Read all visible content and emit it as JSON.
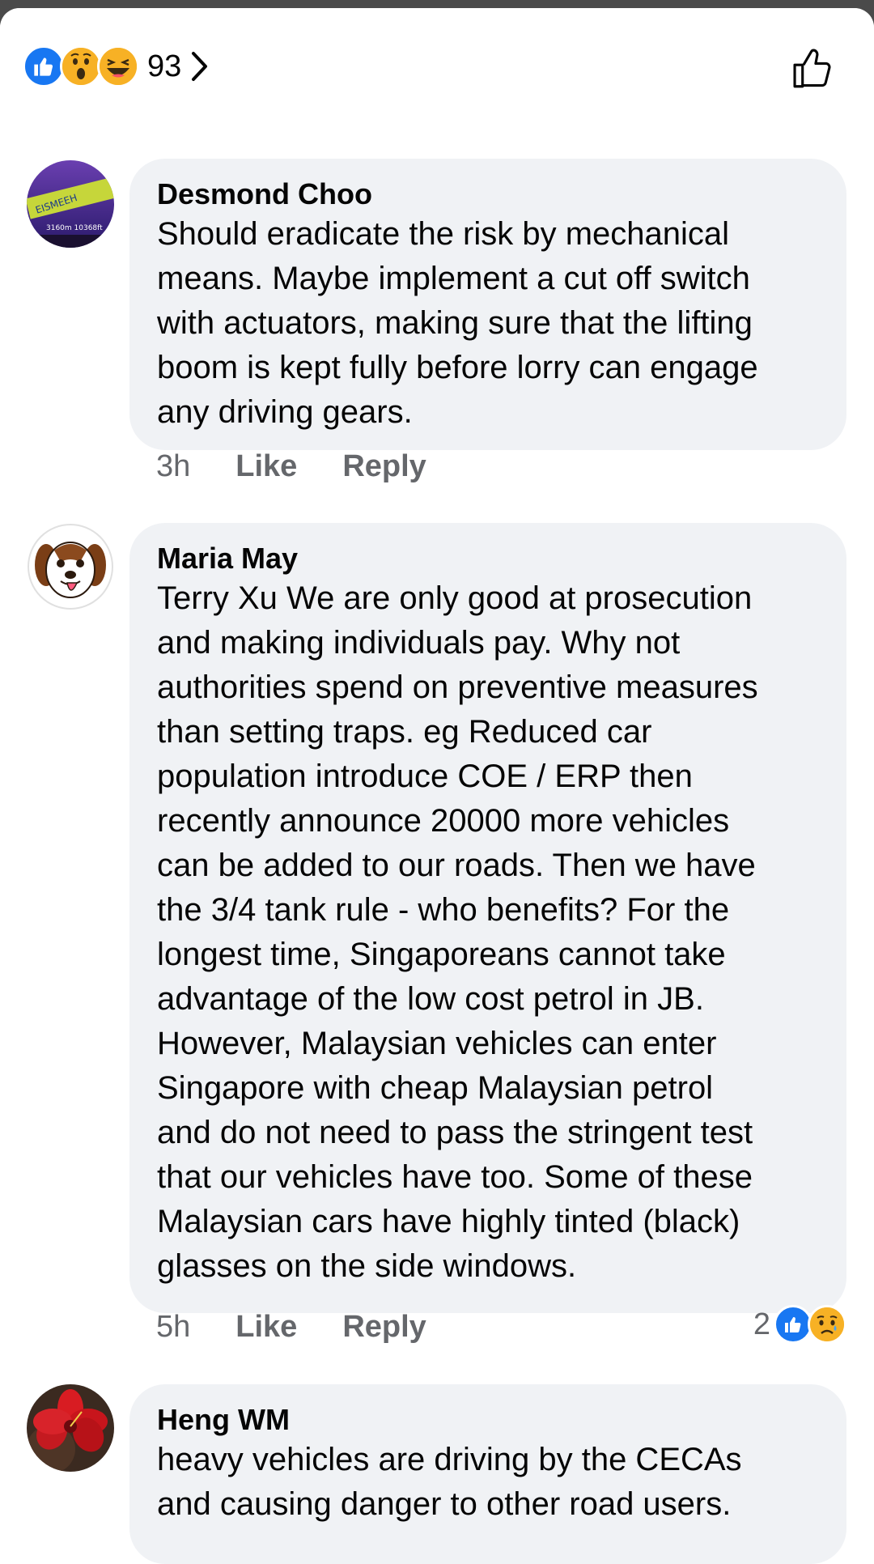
{
  "header": {
    "reaction_icons": [
      "like-icon",
      "wow-icon",
      "haha-icon"
    ],
    "reaction_count": "93",
    "like_button_icon": "thumbs-up-outline-icon"
  },
  "colors": {
    "facebook_blue": "#1877f2",
    "bubble_bg": "#f0f2f5",
    "meta_gray": "#65676b"
  },
  "comments": [
    {
      "author": "Desmond Choo",
      "text": "Should eradicate the risk by mechanical\nmeans. Maybe implement a cut off switch\nwith actuators, making sure that the lifting\nboom is kept fully before lorry can engage\nany driving gears.",
      "time": "3h",
      "like_label": "Like",
      "reply_label": "Reply",
      "avatar_text": "EISMEEH",
      "avatar_subtext": "3160m 10368ft"
    },
    {
      "author": "Maria May",
      "text": "Terry Xu We are only good at prosecution\nand making individuals pay. Why not\nauthorities spend on preventive measures\nthan setting traps. eg Reduced car\npopulation introduce COE / ERP then\nrecently announce 20000 more vehicles\ncan be added to our roads. Then we have\nthe 3/4 tank rule - who benefits? For the\nlongest time, Singaporeans cannot take\nadvantage of the low cost petrol in JB.\nHowever, Malaysian vehicles can enter\nSingapore with cheap Malaysian petrol\nand do not need to pass the stringent test\nthat our vehicles have too. Some of these\nMalaysian cars have highly tinted (black)\nglasses on the side windows.",
      "time": "5h",
      "like_label": "Like",
      "reply_label": "Reply",
      "reaction_count": "2",
      "reaction_icons": [
        "like-icon",
        "sad-icon"
      ]
    },
    {
      "author": "Heng WM",
      "text": "heavy vehicles are driving by the CECAs\nand causing danger to other road users."
    }
  ]
}
